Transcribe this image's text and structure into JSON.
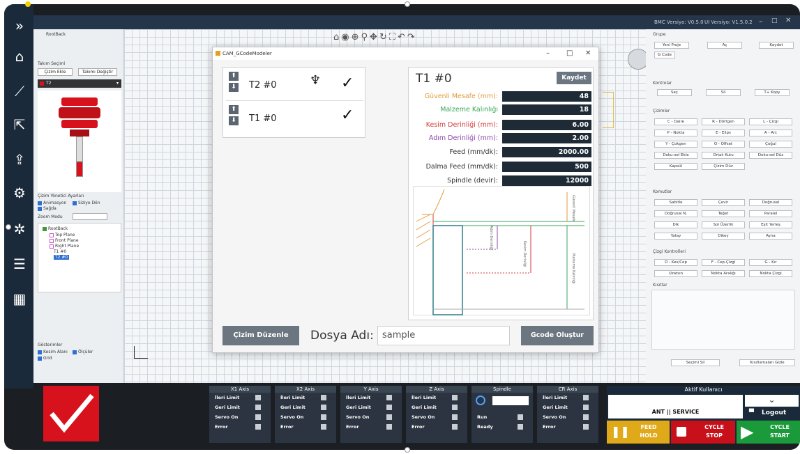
{
  "topbar": {
    "bmc_version": "BMC Versiyo: V0.5.0",
    "ui_version": "UI Versiyo: V1.5.0.2"
  },
  "tree": {
    "root_label": "RootBack",
    "takim_secimi": "Takım Seçimi",
    "btn_cizim": "Çizim Ekle",
    "btn_degistir": "Takımı Değiştir",
    "selected_tool": "T2",
    "opts_title": "Çizim Yönetici Ayarları",
    "opt_animasyon": "Animasyon",
    "opt_sagda": "Sağda",
    "opt_siziya": "Siziye Dön",
    "zoom_label": "Zoom Modu",
    "tree_root": "RootBack",
    "tree_top": "Top Plane",
    "tree_front": "Front Plane",
    "tree_right": "Right Plane",
    "tree_t1": "T1 #0",
    "tree_t2": "T2 #0",
    "gosterimler": "Gösterimler",
    "opt_kesim": "Kesim Alanı",
    "opt_olculer": "Ölçüler",
    "opt_grid": "Grid"
  },
  "right": {
    "genel": "Grupe",
    "yeni_proje": "Yeni Proje",
    "ac": "Aç",
    "kaydet": "Kaydet",
    "g_code": "G Code",
    "kontroller": "Kontrolar",
    "sec": "Seç",
    "sil": "Sil",
    "t_kopy": "T+ Kopy",
    "cizimler": "Çizimler",
    "c_daire": "C - Daire",
    "r_dortgen": "R - Dörtgen",
    "l_cizgi": "L - Çizgi",
    "p_nokta": "P - Nokta",
    "e_elips": "E - Elips",
    "a_arc": "A - Arc",
    "y_cokgen": "Y - Çokgen",
    "o_offset": "O - Offset",
    "cogul": "Çoğul",
    "dokum": "Doku-sel Ekle",
    "ortali": "Ortalı Kutu",
    "dokum_duz": "Doku-sel Düz",
    "kapsul": "Kapsül",
    "cizim_duz": "Çizim Düz",
    "komutlar": "Komutlar",
    "sabitle": "Sabitle",
    "cevir": "Çevir",
    "dogrusal": "Doğrusal",
    "dogrusal_n": "Doğrusal N.",
    "teget": "Teğet",
    "paralel": "Paralel",
    "dik": "Dik",
    "sol_ust": "Sol Üzerlik",
    "esit": "Eşit Yerleş",
    "yatay": "Yatay",
    "dikey": "Dikey",
    "ayna": "Ayna",
    "ciz_kontrol": "Çizgi Kontrolleri",
    "d_kes": "D - Kes/Cep",
    "f_cep": "F - Cep-Çizgi",
    "g_kir": "G - Kır",
    "uzat": "Uzatsın",
    "nokta_araliq": "Nokta Aralığı",
    "nokta_cizgi": "Nokta Çizgi",
    "kisitlar": "Kısıtlar",
    "secimi_sil": "Seçimi Sil",
    "kisitlari_gizle": "Kısıtlamaları Gizle"
  },
  "dialog": {
    "title": "CAM_GCodeModeler",
    "tools": [
      {
        "name": "T2 #0"
      },
      {
        "name": "T1 #0"
      }
    ],
    "tool_title": "T1 #0",
    "save": "Kaydet",
    "params": [
      {
        "label": "Güvenli Mesafe (mm):",
        "value": "48",
        "color": "#e09a3a"
      },
      {
        "label": "Malzeme Kalınlığı",
        "value": "18",
        "color": "#3aa65a"
      },
      {
        "label": "Kesim Derinliği (mm):",
        "value": "6.00",
        "color": "#d43a3a"
      },
      {
        "label": "Adım Derinliği (mm):",
        "value": "2.00",
        "color": "#8e44ad"
      },
      {
        "label": "Feed (mm/dk):",
        "value": "2000.00",
        "color": "#333333"
      },
      {
        "label": "Dalma Feed (mm/dk):",
        "value": "500",
        "color": "#333333"
      },
      {
        "label": "Spindle (devir):",
        "value": "12000",
        "color": "#333333"
      }
    ],
    "diag_guvenli": "Güvenli Mesafe",
    "diag_adim": "Adım Derinliği",
    "diag_kesim": "Kesim Derinliği",
    "diag_malzeme": "Malzeme Kalınlığı",
    "cizim_duzenle": "Çizim Düzenle",
    "dosya_adi": "Dosya Adı:",
    "dosya_value": "sample",
    "gcode": "Gcode Oluştur"
  },
  "axes": [
    {
      "title": "X1 Axis",
      "r1": "İleri Limit",
      "r2": "Geri Limit",
      "r3": "Servo On",
      "r4": "Error"
    },
    {
      "title": "X2 Axis",
      "r1": "İleri Limit",
      "r2": "Geri Limit",
      "r3": "Servo On",
      "r4": "Error"
    },
    {
      "title": "Y Axis",
      "r1": "İleri Limit",
      "r2": "Geri Limit",
      "r3": "Servo On",
      "r4": "Error"
    },
    {
      "title": "Z Axis",
      "r1": "İleri Limit",
      "r2": "Geri Limit",
      "r3": "Servo On",
      "r4": "Error"
    },
    {
      "title": "Spindle",
      "r1": "",
      "r2": "",
      "r3": "Run",
      "r4": "Ready"
    },
    {
      "title": "CR Axis",
      "r1": "İleri Limit",
      "r2": "Geri Limit",
      "r3": "Servo On",
      "r4": "Error"
    }
  ],
  "user": {
    "title": "Aktif Kullanıcı",
    "name": "ANT || SERVICE",
    "logout": "Logout",
    "feed_hold": "FEED\nHOLD",
    "cycle_stop": "CYCLE\nSTOP",
    "cycle_start": "CYCLE\nSTART"
  },
  "colors": {
    "accent": "#d8121d",
    "dark": "#1b2a3a",
    "feed": "#e0a91a",
    "stop": "#c8101a",
    "start": "#1a9a3a"
  }
}
